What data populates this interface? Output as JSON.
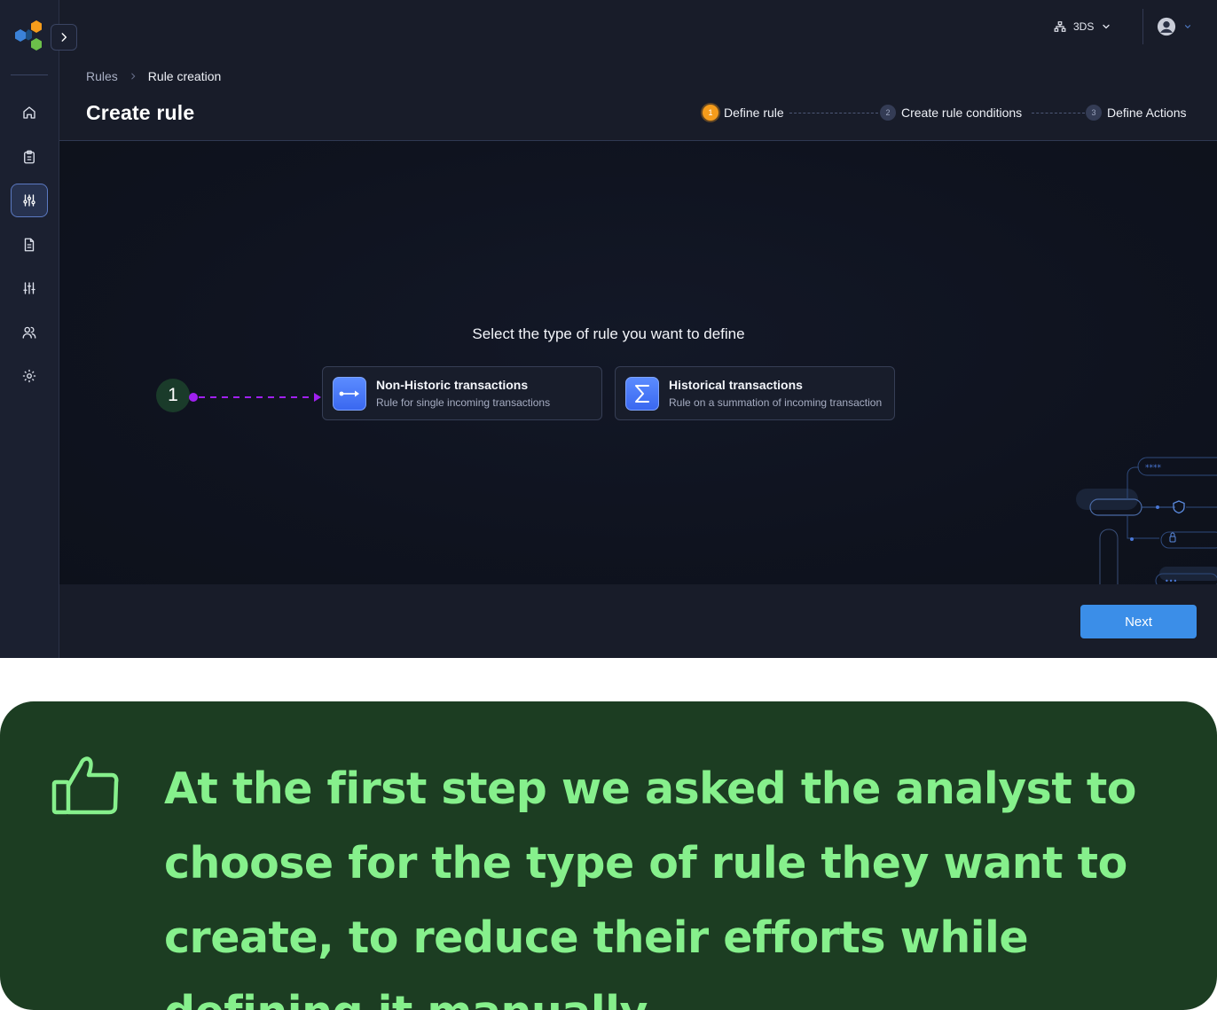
{
  "header": {
    "org_label": "3DS"
  },
  "breadcrumb": {
    "parent": "Rules",
    "current": "Rule creation"
  },
  "page": {
    "title": "Create rule"
  },
  "stepper": {
    "steps": [
      {
        "number": "1",
        "label": "Define rule",
        "state": "current"
      },
      {
        "number": "2",
        "label": "Create rule conditions",
        "state": "upcoming"
      },
      {
        "number": "3",
        "label": "Define Actions",
        "state": "upcoming"
      }
    ]
  },
  "content": {
    "prompt": "Select the type of rule you want to define",
    "callout_number": "1",
    "options": [
      {
        "title": "Non-Historic transactions",
        "subtitle": "Rule for single incoming transactions",
        "icon": "arrow-connector-icon"
      },
      {
        "title": "Historical transactions",
        "subtitle": "Rule on a summation of incoming transaction",
        "icon": "sigma-icon"
      }
    ]
  },
  "decoration": {
    "masked_text": "****",
    "dots_text": "•••"
  },
  "footer": {
    "next_label": "Next"
  },
  "note": {
    "text": "At the first step we asked the analyst to choose for the type of rule they want to create, to reduce their efforts while defining it manually",
    "icon": "thumbs-up-icon"
  },
  "colors": {
    "accent": "#3b8ee8",
    "current_step": "#f59c1b",
    "callout_line": "#a020f0",
    "note_bg": "#1c3d22",
    "note_text": "#86f08c"
  }
}
